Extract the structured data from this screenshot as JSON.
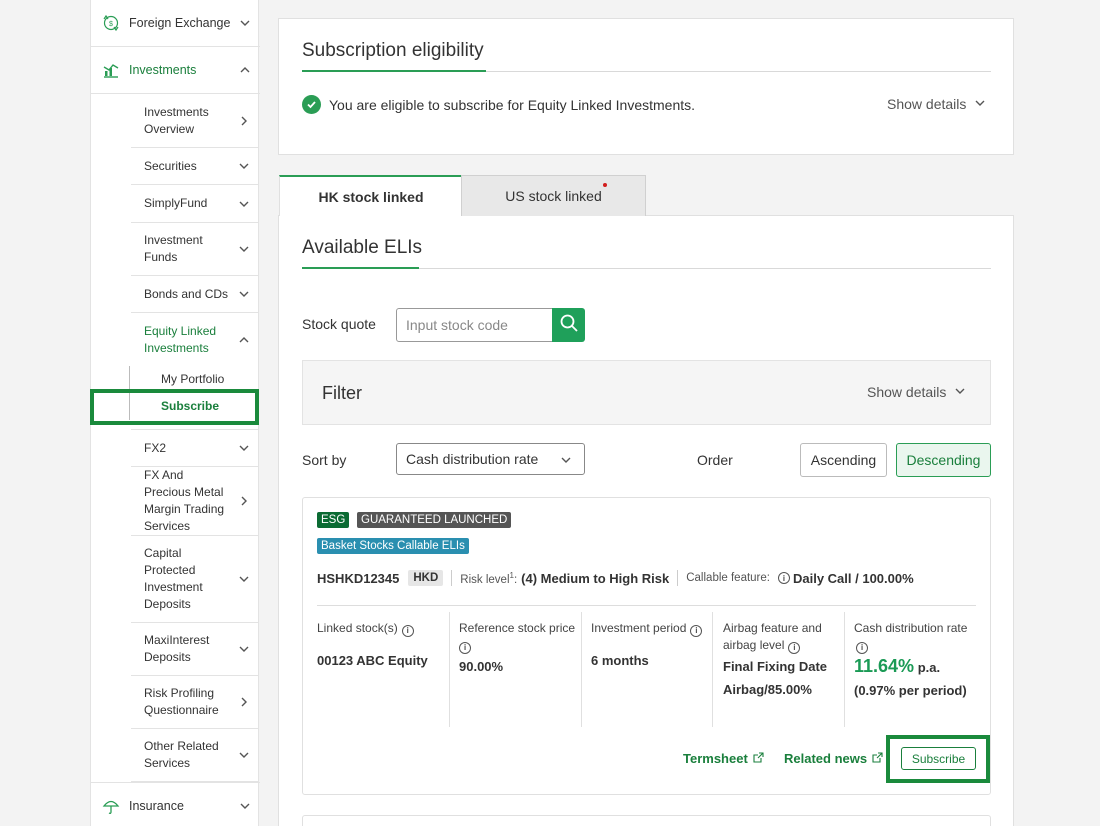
{
  "sidebar": {
    "foreign_exchange": "Foreign Exchange",
    "investments": "Investments",
    "sub_items": [
      "Investments Overview",
      "Securities",
      "SimplyFund",
      "Investment Funds",
      "Bonds and CDs",
      "Equity Linked Investments",
      "FX2",
      "FX And Precious Metal Margin Trading Services",
      "Capital Protected Investment Deposits",
      "MaxiInterest Deposits",
      "Risk Profiling Questionnaire",
      "Other Related Services"
    ],
    "leaf_items": [
      "My Portfolio",
      "Subscribe"
    ],
    "insurance": "Insurance"
  },
  "eligibility": {
    "title": "Subscription eligibility",
    "message": "You are eligible to subscribe for Equity Linked Investments.",
    "show_details": "Show details"
  },
  "tabs": [
    "HK stock linked",
    "US stock linked"
  ],
  "available": {
    "title": "Available ELIs",
    "stock_quote_label": "Stock quote",
    "stock_input_placeholder": "Input stock code",
    "filter_title": "Filter",
    "filter_show_details": "Show details",
    "sort_by_label": "Sort by",
    "sort_value": "Cash distribution rate",
    "order_label": "Order",
    "ascending": "Ascending",
    "descending": "Descending"
  },
  "product": {
    "badge_esg": "ESG",
    "badge_guaranteed": "GUARANTEED LAUNCHED",
    "badge_type": "Basket Stocks Callable ELIs",
    "code": "HSHKD12345",
    "currency": "HKD",
    "risk_label": "Risk level",
    "risk_sup": "1",
    "risk_value": "(4) Medium to High Risk",
    "callable_label": "Callable feature:",
    "callable_value": "Daily Call / 100.00%",
    "linked_stock_head": "Linked stock(s)",
    "linked_stock_val": "00123 ABC Equity",
    "ref_price_head": "Reference stock price",
    "ref_price_val": "90.00%",
    "period_head": "Investment period",
    "period_val": "6 months",
    "airbag_head": "Airbag feature and airbag level",
    "airbag_val": "Final Fixing Date Airbag/85.00%",
    "cash_head": "Cash distribution rate",
    "cash_rate": "11.64%",
    "cash_pa": "p.a.",
    "cash_per_period": "(0.97% per period)",
    "termsheet": "Termsheet",
    "related_news": "Related news",
    "subscribe": "Subscribe"
  },
  "colors": {
    "accent": "#1a7f3c",
    "highlight_box": "#1a8a3c",
    "esg_badge": "#0b6b33",
    "type_badge": "#2a8fb0"
  }
}
